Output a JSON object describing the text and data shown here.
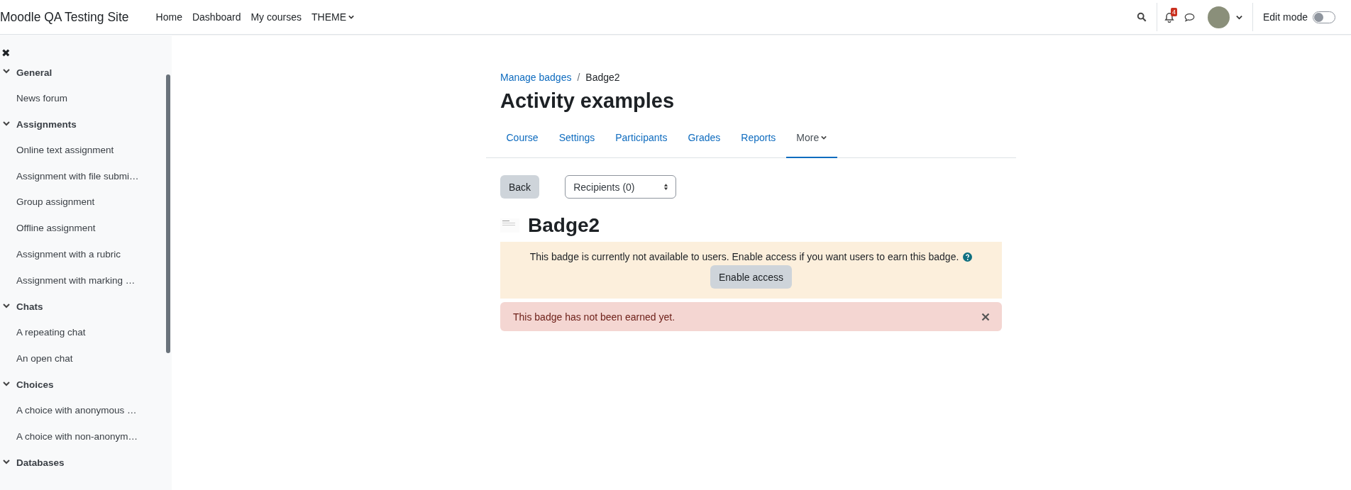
{
  "navbar": {
    "site_name": "Moodle QA Testing Site",
    "links": [
      {
        "label": "Home",
        "kind": "link"
      },
      {
        "label": "Dashboard",
        "kind": "link"
      },
      {
        "label": "My courses",
        "kind": "link"
      },
      {
        "label": "THEME",
        "kind": "dropdown"
      }
    ],
    "notification_count": "4",
    "edit_mode": {
      "label": "Edit mode",
      "on": false
    }
  },
  "sidebar": {
    "close": "✖",
    "sections": [
      {
        "title": "General",
        "expanded": true,
        "items": [
          "News forum"
        ]
      },
      {
        "title": "Assignments",
        "expanded": true,
        "items": [
          "Online text assignment",
          "Assignment with file submi…",
          "Group assignment",
          "Offline assignment",
          "Assignment with a rubric",
          "Assignment with marking …"
        ]
      },
      {
        "title": "Chats",
        "expanded": true,
        "items": [
          "A repeating chat",
          "An open chat"
        ]
      },
      {
        "title": "Choices",
        "expanded": true,
        "items": [
          "A choice with anonymous …",
          "A choice with non-anonym…"
        ]
      },
      {
        "title": "Databases",
        "expanded": true
      }
    ]
  },
  "breadcrumb": [
    {
      "label": "Manage badges",
      "kind": "link"
    },
    {
      "label": "Badge2",
      "kind": "current"
    }
  ],
  "breadcrumb_separator": "/",
  "page_title": "Activity examples",
  "tabs": [
    {
      "label": "Course",
      "selected": false,
      "kind": "link"
    },
    {
      "label": "Settings",
      "selected": false,
      "kind": "link"
    },
    {
      "label": "Participants",
      "selected": false,
      "kind": "link"
    },
    {
      "label": "Grades",
      "selected": false,
      "kind": "link"
    },
    {
      "label": "Reports",
      "selected": false,
      "kind": "link"
    },
    {
      "label": "More",
      "selected": true,
      "kind": "dropdown"
    }
  ],
  "back_button": "Back",
  "recipients_select": "Recipients (0)",
  "badge_name": "Badge2",
  "warning": {
    "text": "This badge is currently not available to users. Enable access if you want users to earn this badge.",
    "button": "Enable access"
  },
  "alert": {
    "text": "This badge has not been earned yet."
  }
}
